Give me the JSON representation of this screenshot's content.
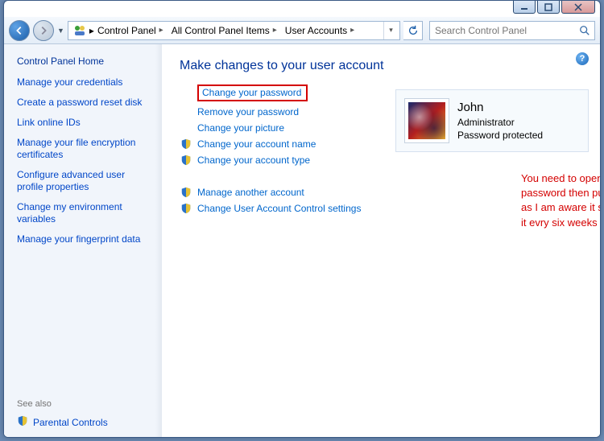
{
  "breadcrumb": {
    "items": [
      "Control Panel",
      "All Control Panel Items",
      "User Accounts"
    ]
  },
  "search": {
    "placeholder": "Search Control Panel"
  },
  "sidebar": {
    "home": "Control Panel Home",
    "links": [
      "Manage your credentials",
      "Create a password reset disk",
      "Link online IDs",
      "Manage your file encryption certificates",
      "Configure advanced user profile properties",
      "Change my environment variables",
      "Manage your fingerprint data"
    ],
    "see_also_label": "See also",
    "parental_controls": "Parental Controls"
  },
  "main": {
    "heading": "Make changes to your user account",
    "actions_primary": [
      {
        "label": "Change your password",
        "shield": false,
        "highlight": true
      },
      {
        "label": "Remove your password",
        "shield": false,
        "highlight": false
      },
      {
        "label": "Change your picture",
        "shield": false,
        "highlight": false
      },
      {
        "label": "Change your account name",
        "shield": true,
        "highlight": false
      },
      {
        "label": "Change your account type",
        "shield": true,
        "highlight": false
      }
    ],
    "actions_secondary": [
      {
        "label": "Manage another account",
        "shield": true
      },
      {
        "label": "Change User Account Control settings",
        "shield": true
      }
    ]
  },
  "user": {
    "name": "John",
    "role": "Administrator",
    "status": "Password protected"
  },
  "annotation": "You need to open this and enter the existing password then put in the one you want as far as I am aware it should not want you to reset it evry six weeks ??",
  "help_glyph": "?"
}
